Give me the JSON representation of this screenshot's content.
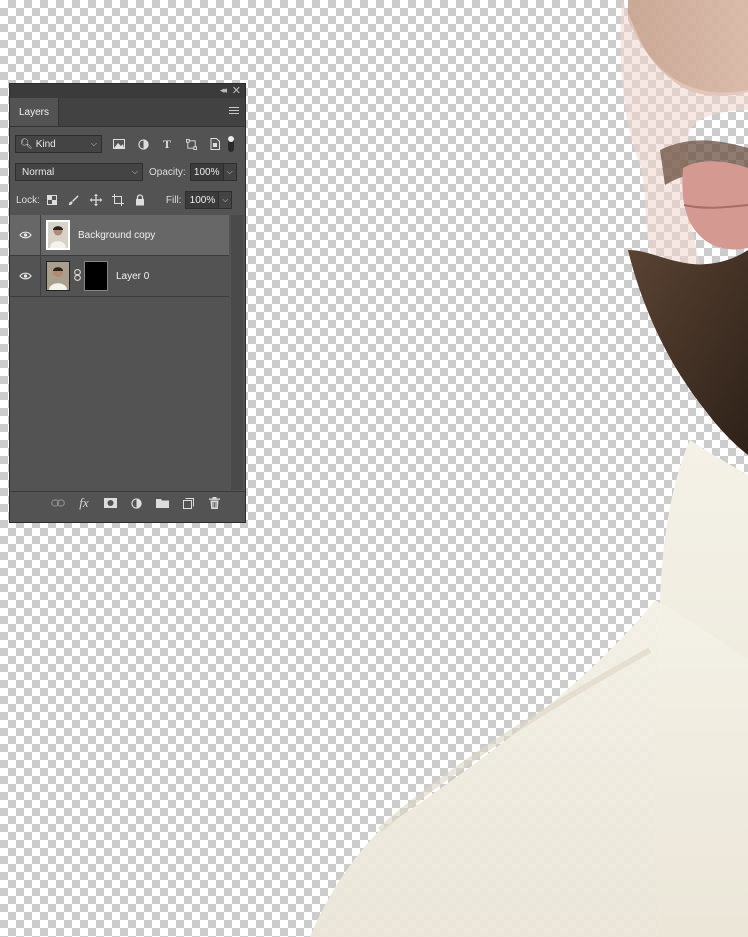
{
  "panel": {
    "tab_label": "Layers",
    "filter": {
      "kind_label": "Kind"
    },
    "blend_mode": "Normal",
    "opacity": {
      "label": "Opacity:",
      "value": "100%"
    },
    "lock": {
      "label": "Lock:"
    },
    "fill": {
      "label": "Fill:",
      "value": "100%"
    },
    "layers": [
      {
        "name": "Background copy",
        "visible": true,
        "selected": true,
        "has_mask": false
      },
      {
        "name": "Layer 0",
        "visible": true,
        "selected": false,
        "has_mask": true
      }
    ],
    "icons": {
      "filter": [
        "image-filter-icon",
        "adjustment-filter-icon",
        "type-filter-icon",
        "shape-filter-icon",
        "smart-object-filter-icon"
      ],
      "lock": [
        "lock-transparent-pixels-icon",
        "lock-image-pixels-icon",
        "lock-position-icon",
        "lock-artboard-icon",
        "lock-all-icon"
      ],
      "bottom": [
        "link-layers-icon",
        "fx-icon",
        "add-mask-icon",
        "adjustment-layer-icon",
        "new-group-icon",
        "new-layer-icon",
        "trash-icon"
      ]
    }
  },
  "colors": {
    "panel_bg": "#535353",
    "selected_row": "#676767",
    "transparency_checker": "#cccccc"
  }
}
